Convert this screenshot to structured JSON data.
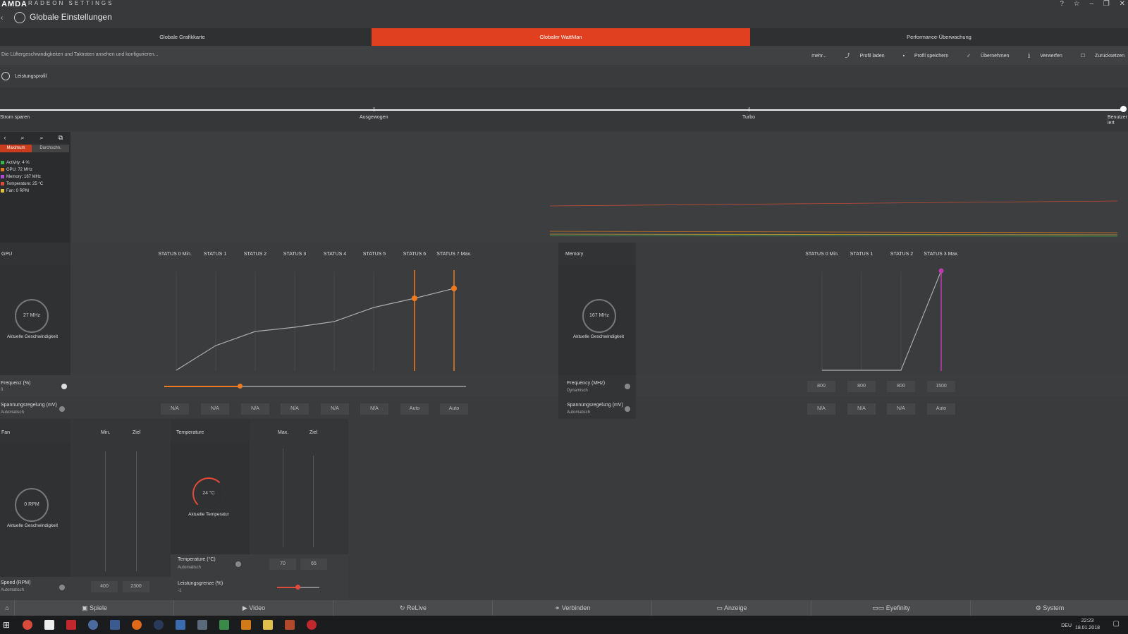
{
  "window": {
    "brand": "AMDA",
    "title": "RADEON SETTINGS",
    "breadcrumb": "Globale Einstellungen",
    "controls": [
      "?",
      "☆",
      "–",
      "❐",
      "✕"
    ]
  },
  "tabs": [
    {
      "label": "Globale Grafikkarte",
      "active": false
    },
    {
      "label": "Globaler WattMan",
      "active": true
    },
    {
      "label": "Performance-Überwachung",
      "active": false
    }
  ],
  "toolbar": {
    "description": "Die Lüftergeschwindigkeiten und Taktraten ansehen und konfigurieren...",
    "more": "mehr...",
    "load": "Profil laden",
    "save": "Profil speichern",
    "apply": "Übernehmen",
    "discard": "Verwerfen",
    "reset": "Zurücksetzen"
  },
  "profile": {
    "label": "Leistungsprofil",
    "positions": [
      "Strom sparen",
      "Ausgewogen",
      "Turbo",
      "Benutzerdefiniert"
    ],
    "current": "Benutzerdefiniert",
    "current_line1": "Benutzer",
    "current_line2": "iert"
  },
  "graph": {
    "max_label": "Maximum",
    "avg_label": "Durchschn.",
    "legend": [
      {
        "label": "Activity: 4 %",
        "color": "#3ab54a"
      },
      {
        "label": "GPU: 72 MHz",
        "color": "#e07a1f"
      },
      {
        "label": "Memory: 167 MHz",
        "color": "#b04ad0"
      },
      {
        "label": "Temperature: 25 °C",
        "color": "#e04a3a"
      },
      {
        "label": "Fan: 0 RPM",
        "color": "#e0c03a"
      }
    ]
  },
  "gpu": {
    "title": "GPU",
    "speed": "27 MHz",
    "speed_caption": "Aktuelle Geschwindigkeit",
    "states": [
      "STATUS 0 Min.",
      "STATUS 1",
      "STATUS 2",
      "STATUS 3",
      "STATUS 4",
      "STATUS 5",
      "STATUS 6",
      "STATUS 7 Max."
    ],
    "freq_label": "Frequenz (%)",
    "freq_value": "0",
    "freq_slider_fraction": 0.25,
    "volt_label": "Spannungsregelung (mV)",
    "volt_mode": "Automatisch",
    "volt_values": [
      "N/A",
      "N/A",
      "N/A",
      "N/A",
      "N/A",
      "N/A",
      "Auto",
      "Auto"
    ]
  },
  "memory": {
    "title": "Memory",
    "speed": "167 MHz",
    "speed_caption": "Aktuelle Geschwindigkeit",
    "states": [
      "STATUS 0 Min.",
      "STATUS 1",
      "STATUS 2",
      "STATUS 3 Max."
    ],
    "freq_label": "Frequency (MHz)",
    "freq_mode": "Dynamisch",
    "freq_values": [
      "800",
      "800",
      "800",
      "1500"
    ],
    "volt_label": "Spannungsregelung (mV)",
    "volt_mode": "Automatisch",
    "volt_values": [
      "N/A",
      "N/A",
      "N/A",
      "Auto"
    ]
  },
  "fan": {
    "title": "Fan",
    "min": "Min.",
    "target": "Ziel",
    "speed": "0 RPM",
    "speed_caption": "Aktuelle Geschwindigkeit",
    "speed_label": "Speed (RPM)",
    "speed_mode": "Automatisch",
    "min_value": "400",
    "target_value": "2300"
  },
  "temperature": {
    "title": "Temperature",
    "max": "Max.",
    "target": "Ziel",
    "current": "24 °C",
    "caption": "Aktuelle Temperatur",
    "ctl_label": "Temperature (°C)",
    "ctl_mode": "Automatisch",
    "max_value": "70",
    "target_value": "65",
    "power_label": "Leistungsgrenze (%)",
    "power_value": "-1",
    "power_fraction": 0.48
  },
  "nav": [
    "Spiele",
    "Video",
    "ReLive",
    "Verbinden",
    "Anzeige",
    "Eyefinity",
    "System"
  ],
  "taskbar": {
    "time": "22:23",
    "date": "18.01.2018",
    "lang": "DEU"
  },
  "colors": {
    "accent": "#e0401f",
    "gpu_curve": "#f07a1f",
    "memory_curve": "#c03ab0"
  }
}
